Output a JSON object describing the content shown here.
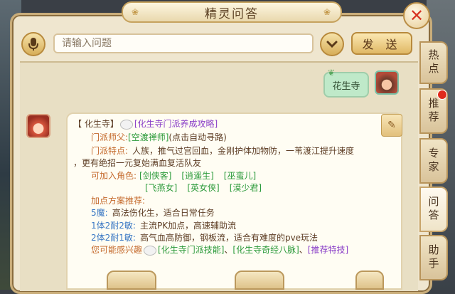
{
  "window": {
    "title": "精灵问答"
  },
  "input": {
    "placeholder": "请输入问题",
    "send_label": "发 送"
  },
  "user_query": {
    "text": "花生寺"
  },
  "reply": {
    "lines": {
      "l1_prefix": "【 化生寺】",
      "l1_link": "[化生寺门派养成攻略]",
      "l2_key": "门派师父:",
      "l2_link": "[空渡禅师]",
      "l2_text": "(点击自动寻路)",
      "l3_key": "门派特点:",
      "l3_text": "人族，推气过宫回血，金刚护体加物防，一苇渡江提升速度",
      "l4_text": "，更有绝招一元复始满血复活队友",
      "l5_key": "可加入角色:",
      "l5_roles": [
        "[剑侠客]",
        "[逍遥生]",
        "[巫蛮儿]"
      ],
      "l6_roles": [
        "[飞燕女]",
        "[英女侠]",
        "[漠少君]"
      ],
      "l7_key": "加点方案推荐:",
      "l8_stat": "5魔:",
      "l8_text": "高法伤化生，适合日常任务",
      "l9_stat": "1体2耐2敏:",
      "l9_text": "主流PK加点，高速辅助流",
      "l10_stat": "2体2耐1敏:",
      "l10_text": "高气血高防御，钢板流，适合有难度的pve玩法",
      "l11_key": "您可能感兴趣",
      "l11_link1": "[化生寺门派技能]",
      "l11_sep1": "、",
      "l11_link2": "[化生寺奇经八脉]",
      "l11_sep2": "、",
      "l11_link3": "[推荐特技]"
    }
  },
  "side_tabs": [
    {
      "label": "热点"
    },
    {
      "label": "推荐"
    },
    {
      "label": "专家"
    },
    {
      "label": "问答"
    },
    {
      "label": "助手"
    }
  ],
  "icons": {
    "close": "close-icon",
    "mic": "microphone-icon",
    "dropdown": "chevron-down-icon",
    "guide": "guide-book-icon"
  }
}
